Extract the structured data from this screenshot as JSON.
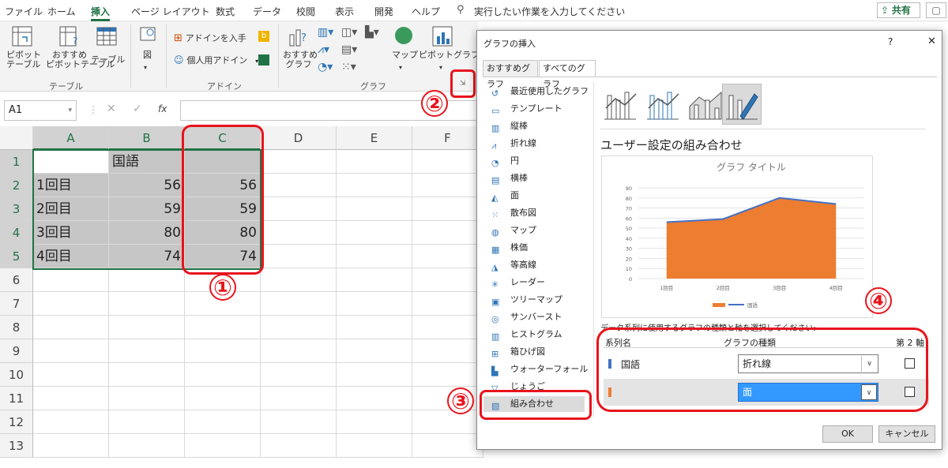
{
  "menu": {
    "items": [
      "ファイル",
      "ホーム",
      "挿入",
      "ページ レイアウト",
      "数式",
      "データ",
      "校閲",
      "表示",
      "開発",
      "ヘルプ"
    ],
    "tell_me": "実行したい作業を入力してください",
    "share": "共有"
  },
  "ribbon": {
    "pivot_table": "ピボット\nテーブル",
    "recommended_pivot": "おすすめ\nピボットテーブル",
    "table": "テーブル",
    "tables_group": "テーブル",
    "illustrations": "図",
    "get_addins": "アドインを入手",
    "my_addins": "個人用アドイン",
    "addins_group": "アドイン",
    "recommended_charts": "おすすめ\nグラフ",
    "maps": "マップ",
    "pivot_chart": "ピボットグラフ",
    "charts_group": "グラフ"
  },
  "formula_bar": {
    "name_box": "A1",
    "fx": "fx"
  },
  "sheet": {
    "columns": [
      "A",
      "B",
      "C",
      "D",
      "E",
      "F"
    ],
    "rows": [
      "1",
      "2",
      "3",
      "4",
      "5",
      "6",
      "7",
      "8",
      "9",
      "10",
      "11",
      "12",
      "13"
    ],
    "b1": "国語",
    "data": [
      {
        "a": "1回目",
        "b": "56",
        "c": "56"
      },
      {
        "a": "2回目",
        "b": "59",
        "c": "59"
      },
      {
        "a": "3回目",
        "b": "80",
        "c": "80"
      },
      {
        "a": "4回目",
        "b": "74",
        "c": "74"
      }
    ]
  },
  "annotations": {
    "n1": "①",
    "n2": "②",
    "n3": "③",
    "n4": "④"
  },
  "dialog": {
    "title": "グラフの挿入",
    "help": "?",
    "close": "✕",
    "tabs": [
      "おすすめグラフ",
      "すべてのグラフ"
    ],
    "chart_types": [
      "最近使用したグラフ",
      "テンプレート",
      "縦棒",
      "折れ線",
      "円",
      "横棒",
      "面",
      "散布図",
      "マップ",
      "株価",
      "等高線",
      "レーダー",
      "ツリーマップ",
      "サンバースト",
      "ヒストグラム",
      "箱ひげ図",
      "ウォーターフォール",
      "じょうご",
      "組み合わせ"
    ],
    "section_title": "ユーザー設定の組み合わせ",
    "chart_title": "グラフ タイトル",
    "series_instructions": "データ系列に使用するグラフの種類と軸を選択してください:",
    "series_header": {
      "name": "系列名",
      "type": "グラフの種類",
      "secondary": "第 2 軸"
    },
    "series": [
      {
        "name": "国語",
        "type": "折れ線",
        "color": "#4472c4"
      },
      {
        "name": "",
        "type": "面",
        "color": "#ed7d31"
      }
    ],
    "ok": "OK",
    "cancel": "キャンセル"
  },
  "chart_data": {
    "type": "area",
    "title": "グラフ タイトル",
    "categories": [
      "1回目",
      "2回目",
      "3回目",
      "4回目"
    ],
    "series": [
      {
        "name": "国語",
        "type": "line",
        "values": [
          56,
          59,
          80,
          74
        ],
        "color": "#4472c4"
      },
      {
        "type": "area",
        "values": [
          56,
          59,
          80,
          74
        ],
        "color": "#ed7d31"
      }
    ],
    "ylim": [
      0,
      90
    ],
    "yticks": [
      0,
      10,
      20,
      30,
      40,
      50,
      60,
      70,
      80,
      90
    ],
    "legend": "bottom",
    "legend_label": "国語",
    "grid": true
  }
}
